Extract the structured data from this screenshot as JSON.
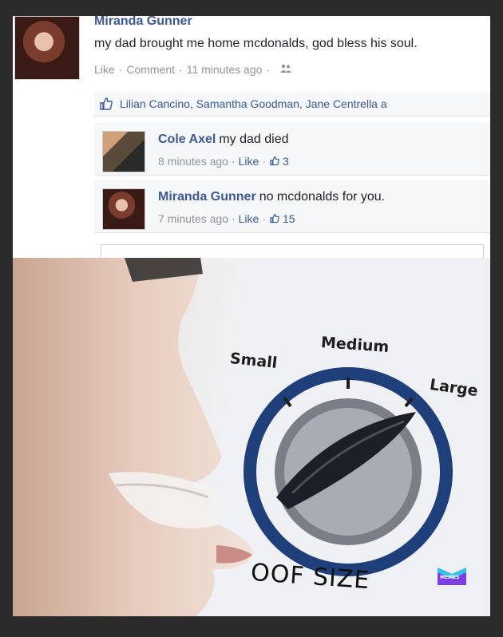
{
  "post": {
    "author": "Miranda Gunner",
    "text": "my dad brought me home mcdonalds, god bless his soul.",
    "actions": [
      "Like",
      "Comment"
    ],
    "time": "11 minutes ago",
    "likes_text": "Lilian Cancino, Samantha Goodman, Jane Centrella a"
  },
  "comments": [
    {
      "author": "Cole Axel",
      "text": "my dad died",
      "time": "8 minutes ago",
      "like_label": "Like",
      "like_count": "3"
    },
    {
      "author": "Miranda Gunner",
      "text": "no mcdonalds for you.",
      "time": "7 minutes ago",
      "like_label": "Like",
      "like_count": "15"
    }
  ],
  "meme": {
    "dial_labels": {
      "small": "Small",
      "medium": "Medium",
      "large": "Large"
    },
    "caption": "OOF SIZE",
    "logo_text": "MEMES"
  },
  "colors": {
    "facebook_blue": "#3b5998",
    "meta_gray": "#90949c",
    "dial_blue": "#1f3f7a",
    "logo_purple": "#7b3fe4"
  },
  "icons": [
    "like-thumb-icon",
    "friends-icon",
    "knob-icon",
    "memes-logo-icon"
  ]
}
